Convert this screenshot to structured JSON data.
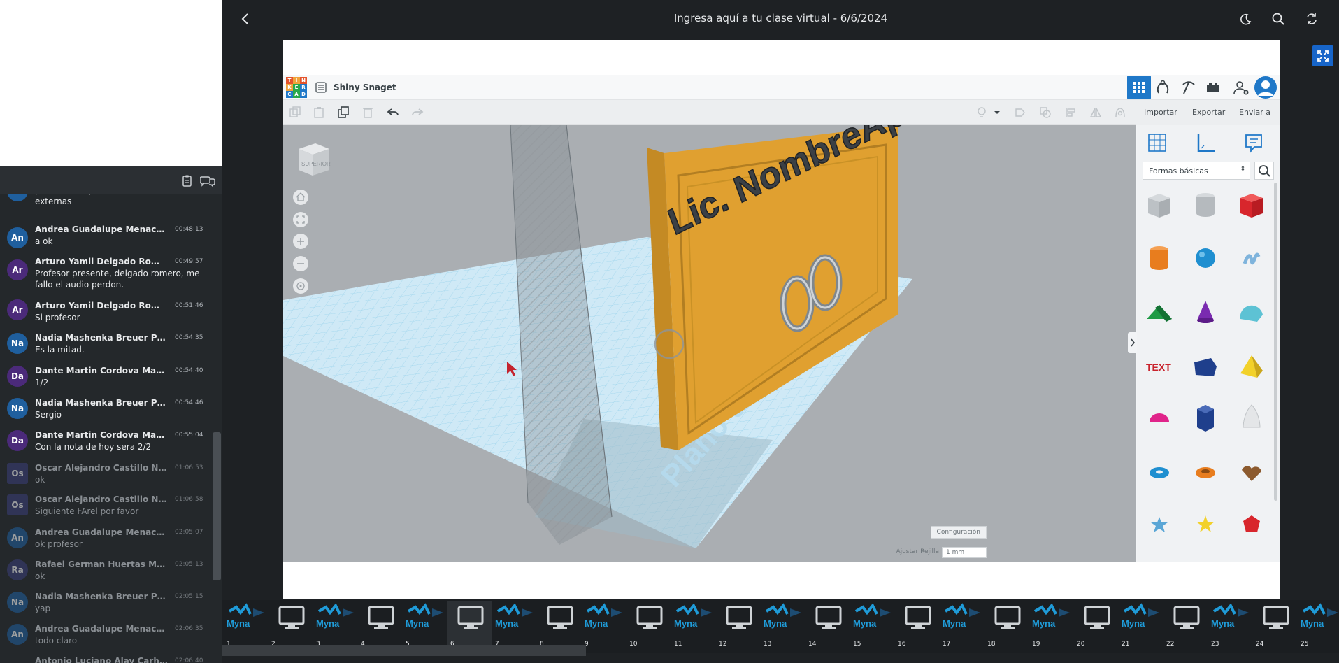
{
  "window": {
    "title": "Ingresa aquí a tu clase virtual - 6/6/2024"
  },
  "chat": {
    "messages": [
      {
        "initials": "",
        "name": "",
        "time": "",
        "text": "profesor me puede derivar a la salas externas",
        "color": "#1f5f9e"
      },
      {
        "initials": "An",
        "name": "Andrea Guadalupe Menacho Rodr...",
        "time": "00:48:13",
        "text": "a ok",
        "color": "#1f5f9e"
      },
      {
        "initials": "Ar",
        "name": "Arturo Yamil Delgado Romero",
        "time": "00:49:57",
        "text": "Profesor presente, delgado romero, me fallo el audio perdon.",
        "color": "#4b2a7a"
      },
      {
        "initials": "Ar",
        "name": "Arturo Yamil Delgado Romero",
        "time": "00:51:46",
        "text": "Si profesor",
        "color": "#4b2a7a"
      },
      {
        "initials": "Na",
        "name": "Nadia Mashenka Breuer Pilco",
        "time": "00:54:35",
        "text": "Es la mitad.",
        "color": "#1f5f9e"
      },
      {
        "initials": "Da",
        "name": "Dante Martin Cordova Martinez",
        "time": "00:54:40",
        "text": "1/2",
        "color": "#4b2a7a"
      },
      {
        "initials": "Na",
        "name": "Nadia Mashenka Breuer Pilco",
        "time": "00:54:46",
        "text": "Sergio",
        "color": "#1f5f9e"
      },
      {
        "initials": "Da",
        "name": "Dante Martin Cordova Martinez",
        "time": "00:55:04",
        "text": "Con la nota de hoy  sera 2/2",
        "color": "#4b2a7a"
      },
      {
        "initials": "Os",
        "name": "Oscar Alejandro Castillo Naveda",
        "time": "01:06:53",
        "text": "ok",
        "color": "#3b3f7a"
      },
      {
        "initials": "Os",
        "name": "Oscar Alejandro Castillo Naveda",
        "time": "01:06:58",
        "text": "Siguiente FArel por favor",
        "color": "#3b3f7a"
      },
      {
        "initials": "An",
        "name": "Andrea Guadalupe Menacho Rodr...",
        "time": "02:05:07",
        "text": "ok profesor",
        "color": "#1f5f9e"
      },
      {
        "initials": "Ra",
        "name": "Rafael German Huertas Montero",
        "time": "02:05:13",
        "text": "ok",
        "color": "#3b3f7a"
      },
      {
        "initials": "Na",
        "name": "Nadia Mashenka Breuer Pilco",
        "time": "02:05:15",
        "text": "yap",
        "color": "#1f5f9e"
      },
      {
        "initials": "An",
        "name": "Andrea Guadalupe Menacho Rodr...",
        "time": "02:06:35",
        "text": "todo claro",
        "color": "#1f5f9e"
      },
      {
        "initials": "",
        "name": "Antonio Luciano Alay Carhuamaca",
        "time": "02:06:40",
        "text": "",
        "color": "#1f5f9e"
      }
    ]
  },
  "tinkercad": {
    "logo_letters": [
      "T",
      "I",
      "N",
      "K",
      "E",
      "R",
      "C",
      "A",
      "D"
    ],
    "design_name": "Shiny Snaget",
    "actions": {
      "import": "Importar",
      "export": "Exportar",
      "send": "Enviar a"
    },
    "shape_category": "Formas básicas",
    "viewcube_label": "SUPERIOR",
    "plate_text": "Lic. NombreApellido",
    "workplane_text": "Plano de trabajo",
    "settings_button": "Configuración",
    "snap_label": "Ajustar Rejilla",
    "snap_value": "1 mm"
  },
  "filmstrip": {
    "brand": "Myna",
    "thumbs": [
      "1",
      "2",
      "3",
      "4",
      "5",
      "6",
      "7",
      "8",
      "9",
      "10",
      "11",
      "12",
      "13",
      "14",
      "15",
      "16",
      "17",
      "18",
      "19",
      "20",
      "21",
      "22",
      "23",
      "24",
      "25"
    ],
    "active_index": 6
  },
  "colors": {
    "accent": "#1765c9",
    "background": "#1e2124",
    "plate": "#e0a030"
  }
}
